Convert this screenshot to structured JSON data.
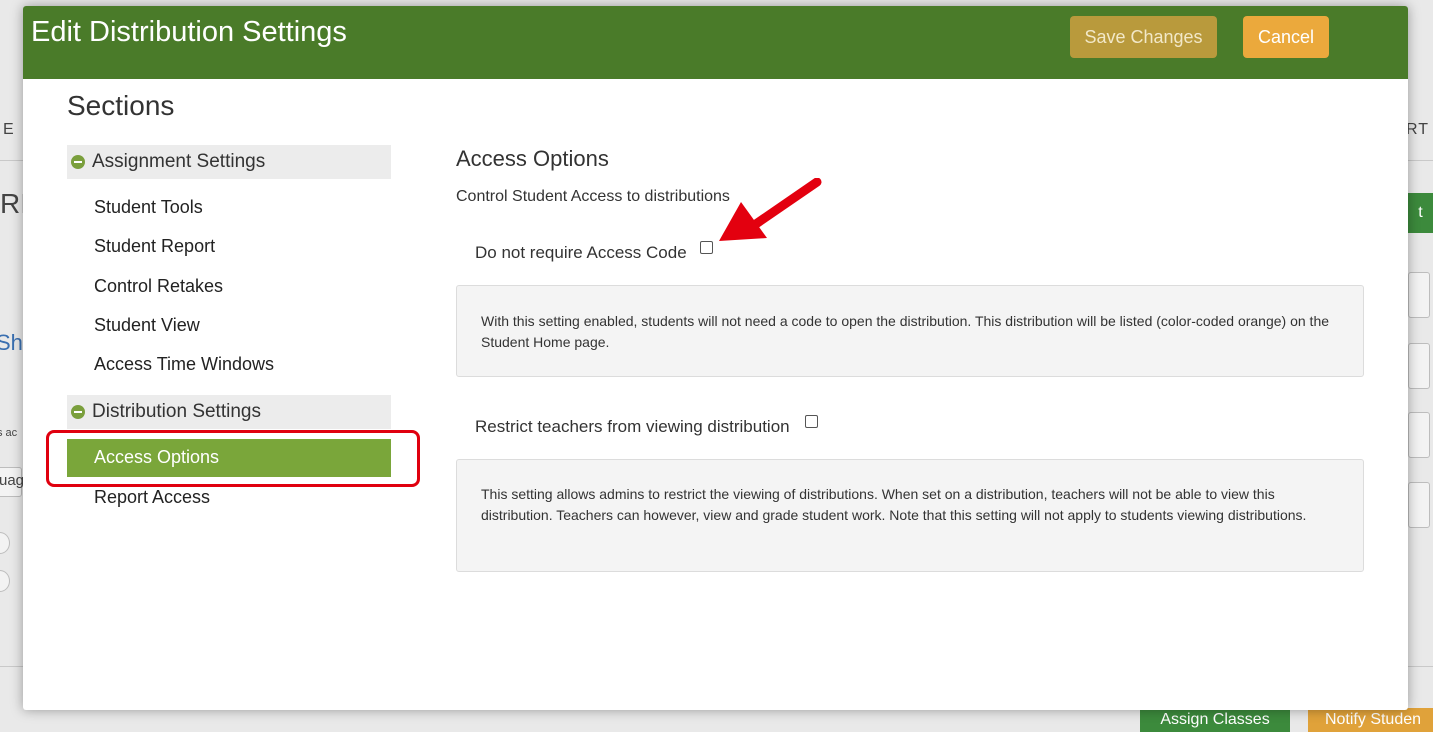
{
  "modal": {
    "title": "Edit Distribution Settings",
    "save_label": "Save Changes",
    "cancel_label": "Cancel"
  },
  "sidebar": {
    "title": "Sections",
    "groups": [
      {
        "label": "Assignment Settings",
        "items": [
          "Student Tools",
          "Student Report",
          "Control Retakes",
          "Student View",
          "Access Time Windows"
        ]
      },
      {
        "label": "Distribution Settings",
        "items": [
          "Access Options",
          "Report Access"
        ],
        "active": "Access Options"
      }
    ]
  },
  "content": {
    "title": "Access Options",
    "subtitle": "Control Student Access to distributions",
    "options": [
      {
        "label": "Do not require Access Code",
        "checked": false,
        "info": "With this setting enabled, students will not need a code to open the distribution. This distribution will be listed (color-coded orange) on the Student Home page."
      },
      {
        "label": "Restrict teachers from viewing distribution",
        "checked": false,
        "info": "This setting allows admins to restrict the viewing of distributions. When set on a distribution, teachers will not be able to view this distribution. Teachers can however, view and grade student work. Note that this setting will not apply to students viewing distributions."
      }
    ]
  },
  "background": {
    "frag_left_1": "E",
    "frag_left_2": "RI",
    "frag_left_3": "Sho",
    "frag_left_4": "s ac",
    "frag_left_5": "uag",
    "frag_right_1": "RT",
    "frag_right_2": "t",
    "assign_classes": "Assign Classes",
    "notify_students": "Notify Studen"
  },
  "colors": {
    "header": "#4a7b29",
    "active_nav": "#7aa63a",
    "save_button": "#b99a3c",
    "cancel_button": "#eba93c",
    "highlight": "#e0000f"
  }
}
